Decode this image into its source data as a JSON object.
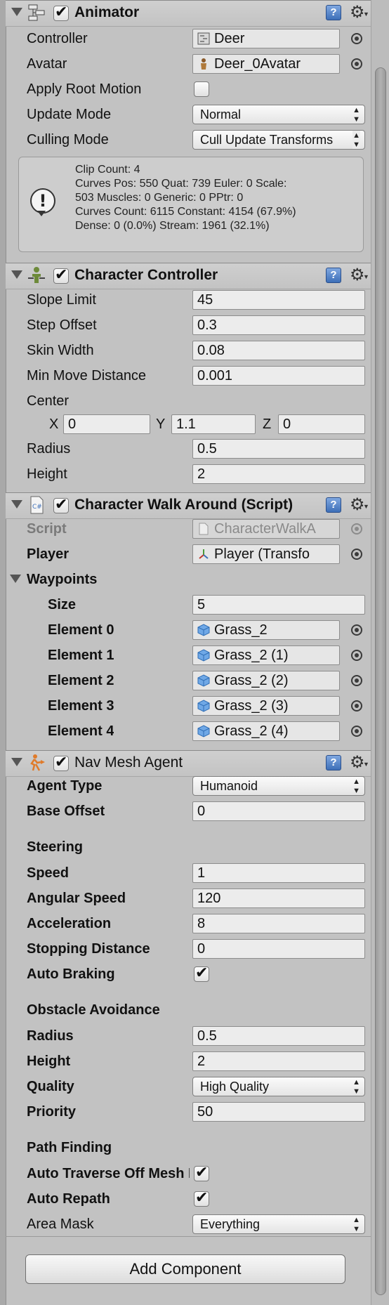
{
  "animator": {
    "title": "Animator",
    "enabled": true,
    "controller_label": "Controller",
    "controller_value": "Deer",
    "avatar_label": "Avatar",
    "avatar_value": "Deer_0Avatar",
    "apply_root_motion_label": "Apply Root Motion",
    "apply_root_motion": false,
    "update_mode_label": "Update Mode",
    "update_mode_value": "Normal",
    "culling_mode_label": "Culling Mode",
    "culling_mode_value": "Cull Update Transforms",
    "info": [
      "Clip Count: 4",
      "Curves Pos: 550 Quat: 739 Euler: 0 Scale:",
      "503 Muscles: 0 Generic: 0 PPtr: 0",
      "Curves Count: 6115 Constant: 4154 (67.9%)",
      "Dense: 0 (0.0%) Stream: 1961 (32.1%)"
    ]
  },
  "character_controller": {
    "title": "Character Controller",
    "enabled": true,
    "slope_limit_label": "Slope Limit",
    "slope_limit": "45",
    "step_offset_label": "Step Offset",
    "step_offset": "0.3",
    "skin_width_label": "Skin Width",
    "skin_width": "0.08",
    "min_move_label": "Min Move Distance",
    "min_move": "0.001",
    "center_label": "Center",
    "x_label": "X",
    "center_x": "0",
    "y_label": "Y",
    "center_y": "1.1",
    "z_label": "Z",
    "center_z": "0",
    "radius_label": "Radius",
    "radius": "0.5",
    "height_label": "Height",
    "height": "2"
  },
  "walk_around": {
    "title": "Character Walk Around (Script)",
    "enabled": true,
    "script_label": "Script",
    "script_value": "CharacterWalkA",
    "player_label": "Player",
    "player_value": "Player (Transfo",
    "waypoints_label": "Waypoints",
    "size_label": "Size",
    "size_value": "5",
    "elements": [
      {
        "label": "Element 0",
        "value": "Grass_2"
      },
      {
        "label": "Element 1",
        "value": "Grass_2 (1)"
      },
      {
        "label": "Element 2",
        "value": "Grass_2 (2)"
      },
      {
        "label": "Element 3",
        "value": "Grass_2 (3)"
      },
      {
        "label": "Element 4",
        "value": "Grass_2 (4)"
      }
    ]
  },
  "nav_mesh_agent": {
    "title": "Nav Mesh Agent",
    "enabled": true,
    "agent_type_label": "Agent Type",
    "agent_type_value": "Humanoid",
    "base_offset_label": "Base Offset",
    "base_offset": "0",
    "steering_label": "Steering",
    "speed_label": "Speed",
    "speed": "1",
    "angular_speed_label": "Angular Speed",
    "angular_speed": "120",
    "acceleration_label": "Acceleration",
    "acceleration": "8",
    "stopping_distance_label": "Stopping Distance",
    "stopping_distance": "0",
    "auto_braking_label": "Auto Braking",
    "auto_braking": true,
    "obstacle_avoidance_label": "Obstacle Avoidance",
    "radius_label": "Radius",
    "radius": "0.5",
    "height_label": "Height",
    "height": "2",
    "quality_label": "Quality",
    "quality_value": "High Quality",
    "priority_label": "Priority",
    "priority": "50",
    "path_finding_label": "Path Finding",
    "auto_traverse_label": "Auto Traverse Off Mesh Link",
    "auto_traverse": true,
    "auto_repath_label": "Auto Repath",
    "auto_repath": true,
    "area_mask_label": "Area Mask",
    "area_mask_value": "Everything"
  },
  "add_component_label": "Add Component",
  "help_glyph": "?",
  "info_glyph": "!",
  "check_glyph": "✔",
  "gear_glyph": "⚙",
  "dropdown_glyph": "▲▼",
  "accent_color": "#3d6fb8"
}
